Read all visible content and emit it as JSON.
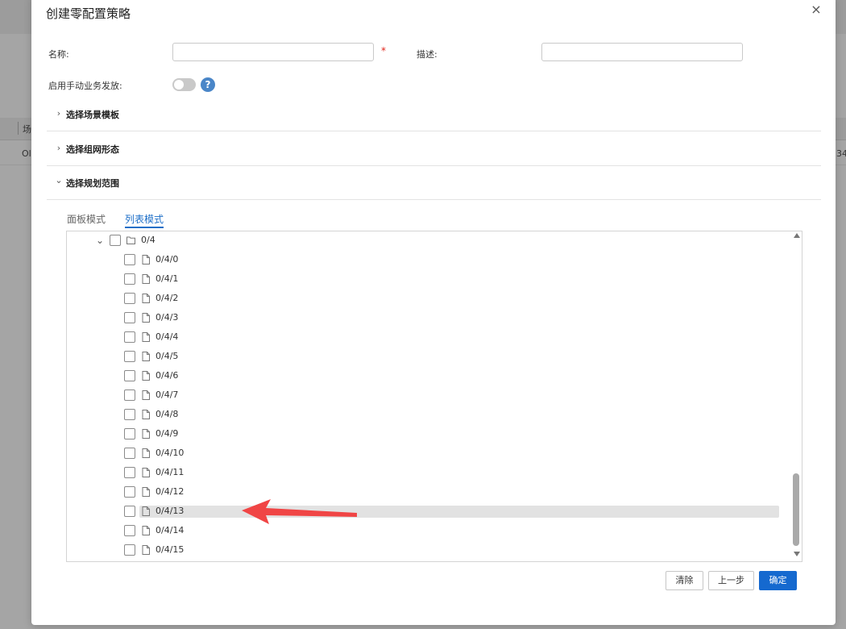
{
  "background": {
    "column_header": "场",
    "row_left": "Ol",
    "row_right": "34:"
  },
  "dialog": {
    "title": "创建零配置策略",
    "close_glyph": "×"
  },
  "form": {
    "name_label": "名称:",
    "name_value": "",
    "required_mark": "*",
    "desc_label": "描述:",
    "desc_value": "",
    "manual_label": "启用手动业务发放:",
    "manual_enabled": false,
    "help_glyph": "?"
  },
  "sections": [
    {
      "label": "选择场景模板",
      "expanded": false
    },
    {
      "label": "选择组网形态",
      "expanded": false
    },
    {
      "label": "选择规划范围",
      "expanded": true
    }
  ],
  "tabs": [
    {
      "label": "面板模式",
      "active": false
    },
    {
      "label": "列表模式",
      "active": true
    }
  ],
  "tree": {
    "parent": {
      "label": "0/4",
      "checked": false,
      "expanded": true,
      "icon": "folder-icon"
    },
    "children": [
      {
        "label": "0/4/0",
        "checked": false
      },
      {
        "label": "0/4/1",
        "checked": false
      },
      {
        "label": "0/4/2",
        "checked": false
      },
      {
        "label": "0/4/3",
        "checked": false
      },
      {
        "label": "0/4/4",
        "checked": false
      },
      {
        "label": "0/4/5",
        "checked": false
      },
      {
        "label": "0/4/6",
        "checked": false
      },
      {
        "label": "0/4/7",
        "checked": false
      },
      {
        "label": "0/4/8",
        "checked": false
      },
      {
        "label": "0/4/9",
        "checked": false
      },
      {
        "label": "0/4/10",
        "checked": false
      },
      {
        "label": "0/4/11",
        "checked": false
      },
      {
        "label": "0/4/12",
        "checked": false
      },
      {
        "label": "0/4/13",
        "checked": false,
        "highlighted": true
      },
      {
        "label": "0/4/14",
        "checked": false
      },
      {
        "label": "0/4/15",
        "checked": false
      }
    ]
  },
  "buttons": {
    "clear": "清除",
    "prev": "上一步",
    "confirm": "确定"
  },
  "colors": {
    "primary": "#1569cf",
    "tab_active": "#1e6fc8",
    "required": "#e1251b",
    "annotation_arrow": "#f04545",
    "help_icon": "#4a86c8"
  }
}
